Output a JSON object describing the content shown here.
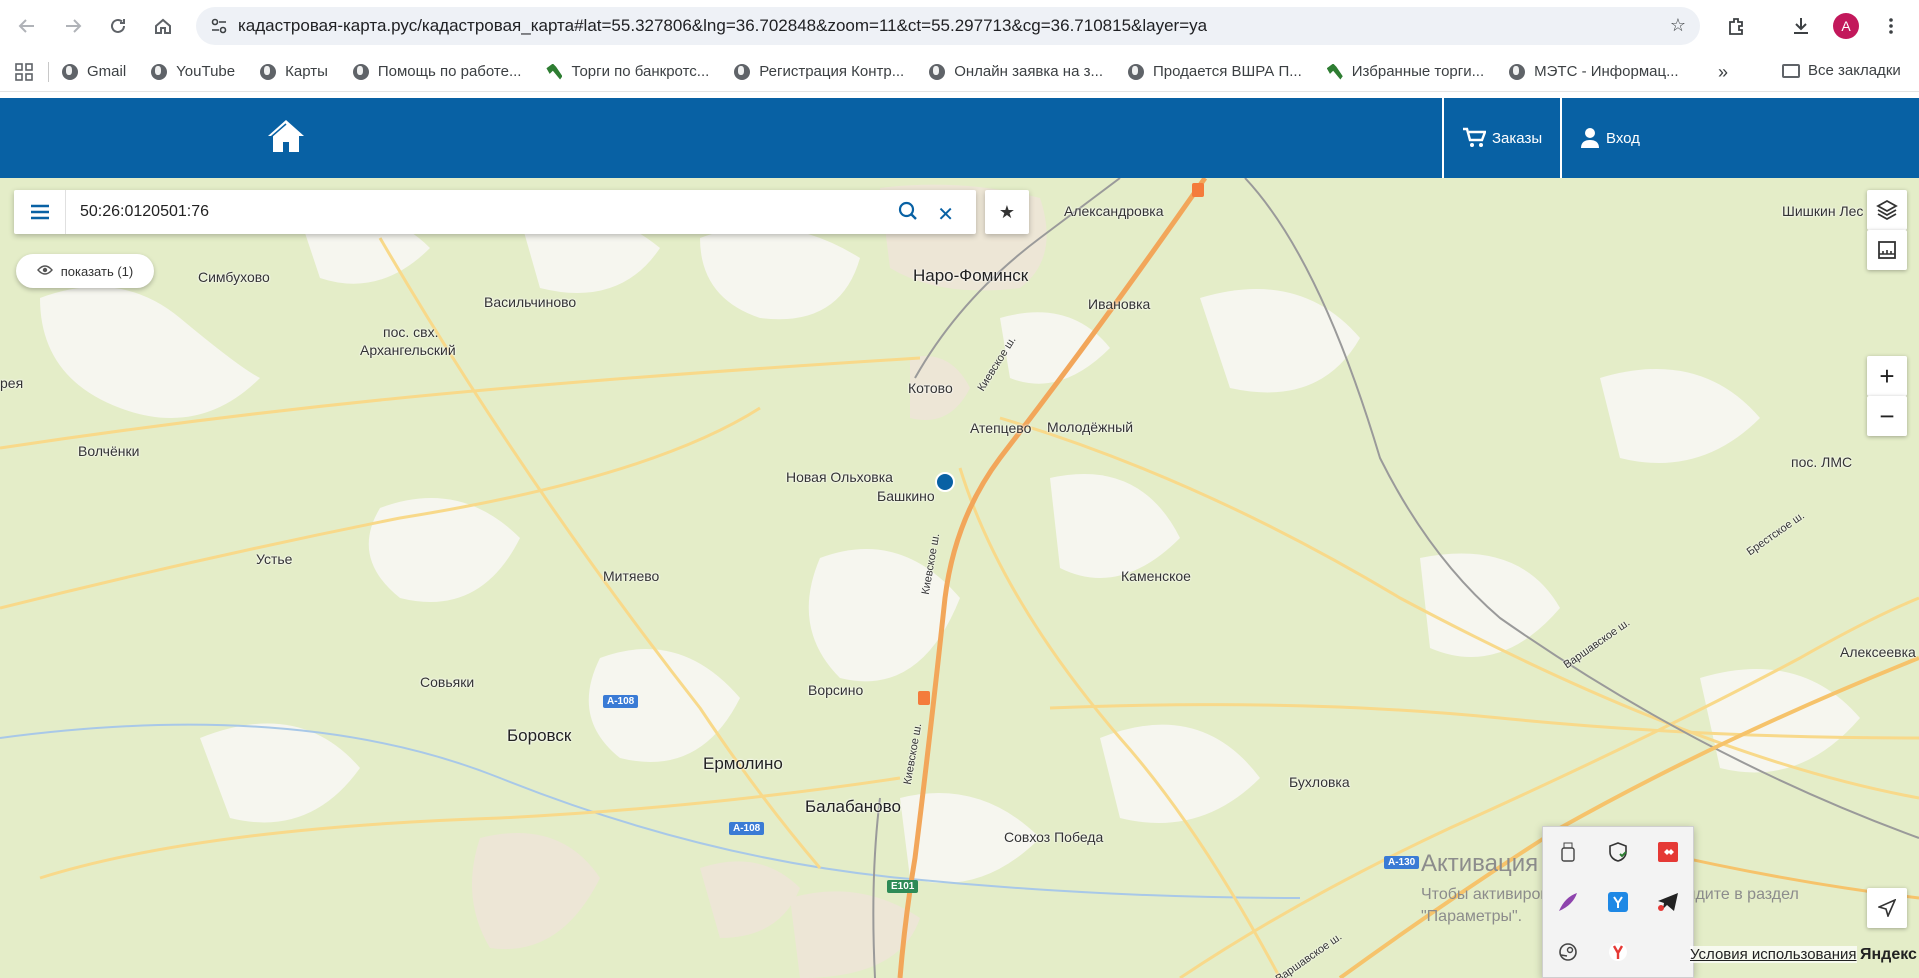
{
  "browser": {
    "url": "кадастровая-карта.рус/кадастровая_карта#lat=55.327806&lng=36.702848&zoom=11&ct=55.297713&cg=36.710815&layer=ya",
    "avatar_letter": "A",
    "bookmarks": [
      {
        "label": "Gmail",
        "icon": "globe-icon"
      },
      {
        "label": "YouTube",
        "icon": "globe-icon"
      },
      {
        "label": "Карты",
        "icon": "globe-icon"
      },
      {
        "label": "Помощь по работе...",
        "icon": "globe-icon"
      },
      {
        "label": "Торги по банкротс...",
        "icon": "hammer-icon"
      },
      {
        "label": "Регистрация Контр...",
        "icon": "globe-icon"
      },
      {
        "label": "Онлайн заявка на з...",
        "icon": "globe-icon"
      },
      {
        "label": "Продается ВШРА П...",
        "icon": "globe-icon"
      },
      {
        "label": "Избранные торги...",
        "icon": "hammer-icon"
      },
      {
        "label": "МЭТС - Информац...",
        "icon": "globe-icon"
      }
    ],
    "all_bookmarks": "Все закладки"
  },
  "header": {
    "orders_label": "Заказы",
    "login_label": "Вход",
    "color": "#0861a4"
  },
  "map": {
    "search_value": "50:26:0120501:76",
    "show_button": "показать (1)",
    "zoom_in": "+",
    "zoom_out": "−",
    "places": [
      {
        "name": "Александровка"
      },
      {
        "name": "Шишкин Лес"
      },
      {
        "name": "Симбухово"
      },
      {
        "name": "Наро-Фоминск"
      },
      {
        "name": "Васильчиново"
      },
      {
        "name": "Ивановка"
      },
      {
        "name": "пос. свх."
      },
      {
        "name": "Архангельский"
      },
      {
        "name": "Котово"
      },
      {
        "name": "Атепцево"
      },
      {
        "name": "Молодёжный"
      },
      {
        "name": "рея"
      },
      {
        "name": "Волчёнки"
      },
      {
        "name": "пос. ЛМС"
      },
      {
        "name": "Новая Ольховка"
      },
      {
        "name": "Башкино"
      },
      {
        "name": "Устье"
      },
      {
        "name": "Митяево"
      },
      {
        "name": "Каменское"
      },
      {
        "name": "Совьяки"
      },
      {
        "name": "Ворсино"
      },
      {
        "name": "Алексеевка"
      },
      {
        "name": "Боровск"
      },
      {
        "name": "Ермолино"
      },
      {
        "name": "Бухловка"
      },
      {
        "name": "Балабаново"
      },
      {
        "name": "Совхоз Победа"
      }
    ],
    "road_labels": [
      "Киевское ш.",
      "Киевское ш.",
      "Киевское ш.",
      "Варшавское ш.",
      "Брестское ш.",
      "Варшавское ш."
    ],
    "road_badges": [
      "А-108",
      "А-108",
      "Е101",
      "А-130"
    ],
    "windows_activation_title": "Активация Windows",
    "windows_activation_text1": "Чтобы активировать Windows, перейдите в раздел",
    "windows_activation_text2": "\"Параметры\".",
    "terms": "Условия использования",
    "provider": "Яндекс"
  }
}
